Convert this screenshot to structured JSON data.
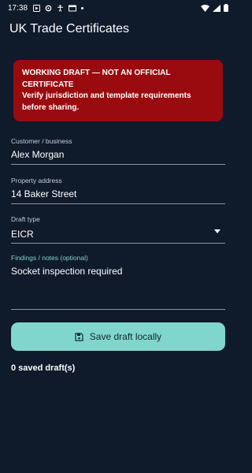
{
  "status_bar": {
    "time": "17:38"
  },
  "app": {
    "title": "UK Trade Certificates"
  },
  "warning": {
    "lines": [
      "WORKING DRAFT — NOT AN OFFICIAL",
      "CERTIFICATE",
      "Verify jurisdiction and template requirements",
      "before sharing."
    ]
  },
  "form": {
    "customer": {
      "label": "Customer / business",
      "value": "Alex Morgan"
    },
    "address": {
      "label": "Property address",
      "value": "14 Baker Street"
    },
    "draft_type": {
      "label": "Draft type",
      "value": "EICR"
    },
    "notes": {
      "label": "Findings / notes (optional)",
      "value": "Socket inspection required"
    }
  },
  "actions": {
    "save_label": "Save draft locally"
  },
  "saved": {
    "count_text": "0 saved draft(s)"
  },
  "colors": {
    "background": "#0f1a2a",
    "warning": "#9a0b0f",
    "accent": "#80d6cd"
  },
  "icons": {
    "save": "floppy-disk-icon",
    "dropdown": "dropdown-arrow-icon"
  }
}
